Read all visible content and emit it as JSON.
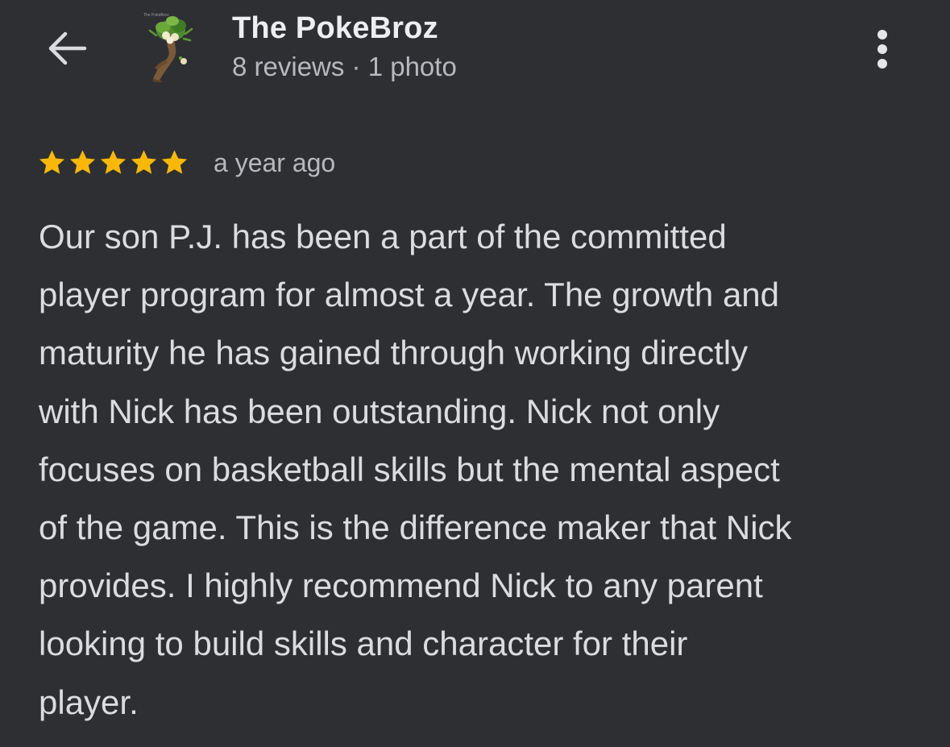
{
  "header": {
    "back_icon": "arrow-left-icon",
    "avatar_caption": "The PokeBroz",
    "name": "The PokeBroz",
    "meta": "8 reviews · 1 photo",
    "more_icon": "more-vertical-icon"
  },
  "review": {
    "rating": 5,
    "rating_max": 5,
    "star_color": "#f9b808",
    "timestamp": "a year ago",
    "lines": [
      "Our son P.J. has been a part of the committed",
      "player program for almost a year. The growth and",
      "maturity he has gained through working directly",
      "with Nick has been outstanding. Nick not only",
      "focuses on basketball skills but the mental aspect",
      "of the game. This is the difference maker that Nick",
      "provides. I highly recommend Nick to any parent",
      "looking to build skills and character for their",
      "player."
    ]
  },
  "colors": {
    "background": "#2e2f33",
    "primary_text": "#eceef1",
    "secondary_text": "#b6b9be",
    "body_text": "#dadce0"
  }
}
